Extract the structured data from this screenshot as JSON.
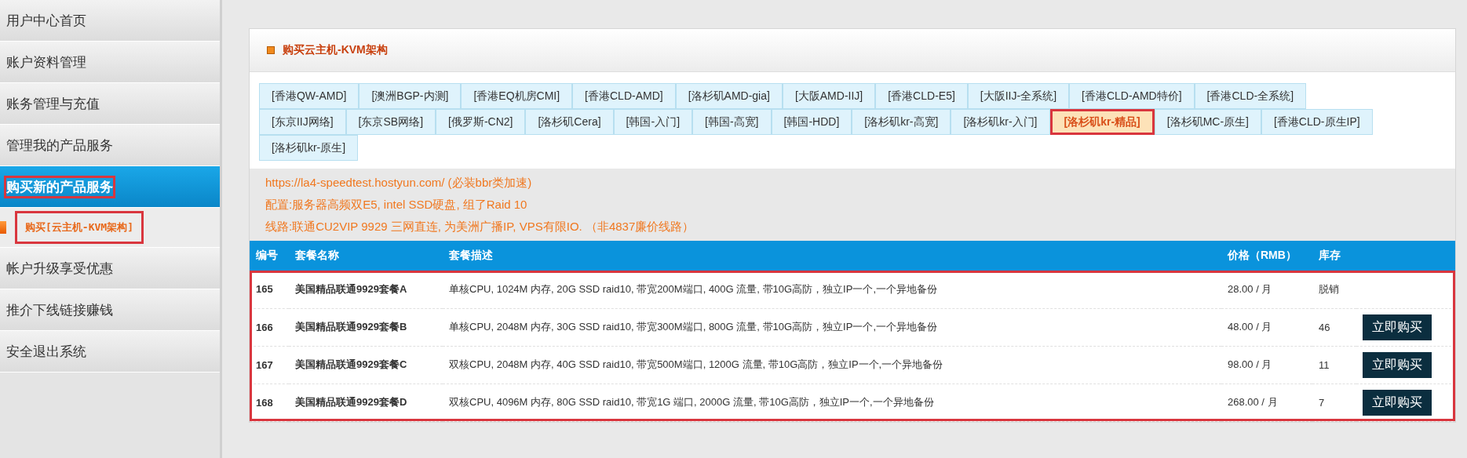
{
  "sidebar": {
    "items": [
      {
        "label": "用户中心首页",
        "selected": false,
        "highlighted": false
      },
      {
        "label": "账户资料管理",
        "selected": false,
        "highlighted": false
      },
      {
        "label": "账务管理与充值",
        "selected": false,
        "highlighted": false
      },
      {
        "label": "管理我的产品服务",
        "selected": false,
        "highlighted": false
      },
      {
        "label": "购买新的产品服务",
        "selected": true,
        "highlighted": true,
        "children": [
          {
            "label": "购买[云主机-KVM架构]",
            "selected": true,
            "highlighted": true
          }
        ]
      },
      {
        "label": "帐户升级享受优惠",
        "selected": false,
        "highlighted": false
      },
      {
        "label": "推介下线链接赚钱",
        "selected": false,
        "highlighted": false
      },
      {
        "label": "安全退出系统",
        "selected": false,
        "highlighted": false
      }
    ]
  },
  "panel": {
    "title": "购买云主机-KVM架构",
    "tabs": [
      {
        "label": "[香港QW-AMD]",
        "selected": false
      },
      {
        "label": "[澳洲BGP-内测]",
        "selected": false
      },
      {
        "label": "[香港EQ机房CMI]",
        "selected": false
      },
      {
        "label": "[香港CLD-AMD]",
        "selected": false
      },
      {
        "label": "[洛杉矶AMD-gia]",
        "selected": false
      },
      {
        "label": "[大阪AMD-IIJ]",
        "selected": false
      },
      {
        "label": "[香港CLD-E5]",
        "selected": false
      },
      {
        "label": "[大阪IIJ-全系统]",
        "selected": false
      },
      {
        "label": "[香港CLD-AMD特价]",
        "selected": false
      },
      {
        "label": "[香港CLD-全系统]",
        "selected": false
      },
      {
        "label": "[东京IIJ网络]",
        "selected": false
      },
      {
        "label": "[东京SB网络]",
        "selected": false
      },
      {
        "label": "[俄罗斯-CN2]",
        "selected": false
      },
      {
        "label": "[洛杉矶Cera]",
        "selected": false
      },
      {
        "label": "[韩国-入门]",
        "selected": false
      },
      {
        "label": "[韩国-高宽]",
        "selected": false
      },
      {
        "label": "[韩国-HDD]",
        "selected": false
      },
      {
        "label": "[洛杉矶kr-高宽]",
        "selected": false
      },
      {
        "label": "[洛杉矶kr-入门]",
        "selected": false
      },
      {
        "label": "[洛杉矶kr-精品]",
        "selected": true
      },
      {
        "label": "[洛杉矶MC-原生]",
        "selected": false
      },
      {
        "label": "[香港CLD-原生IP]",
        "selected": false
      },
      {
        "label": "[洛杉矶kr-原生]",
        "selected": false
      }
    ],
    "info": [
      "https://la4-speedtest.hostyun.com/ (必装bbr类加速)",
      "配置:服务器高频双E5, intel SSD硬盘, 组了Raid 10",
      "线路:联通CU2VIP 9929 三网直连, 为美洲广播IP, VPS有限IO. （非4837廉价线路）"
    ],
    "table": {
      "highlighted": true,
      "columns": [
        "编号",
        "套餐名称",
        "套餐描述",
        "价格（RMB）",
        "库存"
      ],
      "rows": [
        {
          "id": "165",
          "name": "美国精品联通9929套餐A",
          "description": "单核CPU, 1024M 内存, 20G SSD raid10, 带宽200M端口, 400G 流量, 带10G高防，独立IP一个,一个异地备份",
          "price": "28.00 / 月",
          "stock": "脱销"
        },
        {
          "id": "166",
          "name": "美国精品联通9929套餐B",
          "description": "单核CPU, 2048M 内存, 30G SSD raid10, 带宽300M端口, 800G 流量, 带10G高防，独立IP一个,一个异地备份",
          "price": "48.00 / 月",
          "stock": "46",
          "button": "立即购买"
        },
        {
          "id": "167",
          "name": "美国精品联通9929套餐C",
          "description": "双核CPU, 2048M 内存, 40G SSD raid10, 带宽500M端口, 1200G 流量, 带10G高防，独立IP一个,一个异地备份",
          "price": "98.00 / 月",
          "stock": "11",
          "button": "立即购买"
        },
        {
          "id": "168",
          "name": "美国精品联通9929套餐D",
          "description": "双核CPU, 4096M 内存, 80G SSD raid10, 带宽1G 端口, 2000G 流量, 带10G高防，独立IP一个,一个异地备份",
          "price": "268.00 / 月",
          "stock": "7",
          "button": "立即购买"
        }
      ]
    }
  }
}
